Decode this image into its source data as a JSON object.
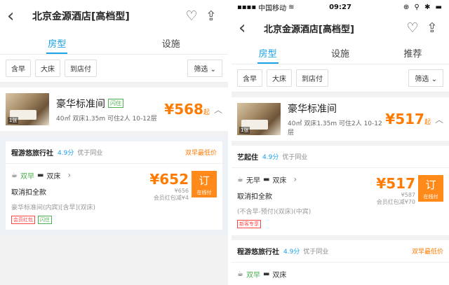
{
  "left": {
    "nav": {
      "title": "北京金源酒店[高档型]"
    },
    "tabs": [
      {
        "label": "房型"
      },
      {
        "label": "设施"
      }
    ],
    "filters": [
      {
        "label": "含早"
      },
      {
        "label": "大床"
      },
      {
        "label": "到店付"
      }
    ],
    "sort_label": "筛选",
    "room": {
      "name": "豪华标准间",
      "tag": "闪住",
      "desc": "40㎡ 双床1.35m 可住2人 10-12层",
      "price": "¥568",
      "price_suffix": "起",
      "thumb_count": "1张"
    },
    "package": {
      "agent": "程游悠旅行社",
      "score": "4.9分",
      "compare": "优于同业",
      "badge": "双早最低价",
      "meal": "双早",
      "bed": "双床",
      "cancel": "取消扣全款",
      "sub": "豪华标准间(内宾)[含早](双床)",
      "promos": [
        "会员红包",
        "闪住"
      ],
      "price": "¥652",
      "old_price": "¥656",
      "member_off": "会员红包减¥4",
      "book_label": "订",
      "book_sub": "在线付"
    }
  },
  "right": {
    "status": {
      "carrier": "中国移动",
      "time": "09:27",
      "icons": "⊕ ⚲ ✱ ▬"
    },
    "nav": {
      "title": "北京金源酒店[高档型]"
    },
    "tabs": [
      {
        "label": "房型"
      },
      {
        "label": "设施"
      },
      {
        "label": "推荐"
      }
    ],
    "filters": [
      {
        "label": "含早"
      },
      {
        "label": "大床"
      },
      {
        "label": "到店付"
      }
    ],
    "sort_label": "筛选",
    "room": {
      "name": "豪华标准间",
      "desc": "40㎡ 双床1.35m 可住2人 10-12层",
      "price": "¥517",
      "price_suffix": "起",
      "thumb_count": "1张"
    },
    "package1": {
      "agent": "艺起住",
      "score": "4.9分",
      "compare": "优于同业",
      "meal": "无早",
      "bed": "双床",
      "cancel": "取消扣全款",
      "sub": "(不含早-预付)(双床)(中宾)",
      "promo": "新客专享",
      "price": "¥517",
      "old_price": "¥587",
      "member_off": "会员红包减¥70",
      "book_label": "订",
      "book_sub": "在线付"
    },
    "package2": {
      "agent": "程游悠旅行社",
      "score": "4.9分",
      "compare": "优于同业",
      "badge": "双早最低价",
      "meal": "双早",
      "bed": "双床"
    }
  },
  "colors": {
    "accent": "#1aa1e6",
    "price": "#ff7a00",
    "book": "#ff8a1a"
  }
}
